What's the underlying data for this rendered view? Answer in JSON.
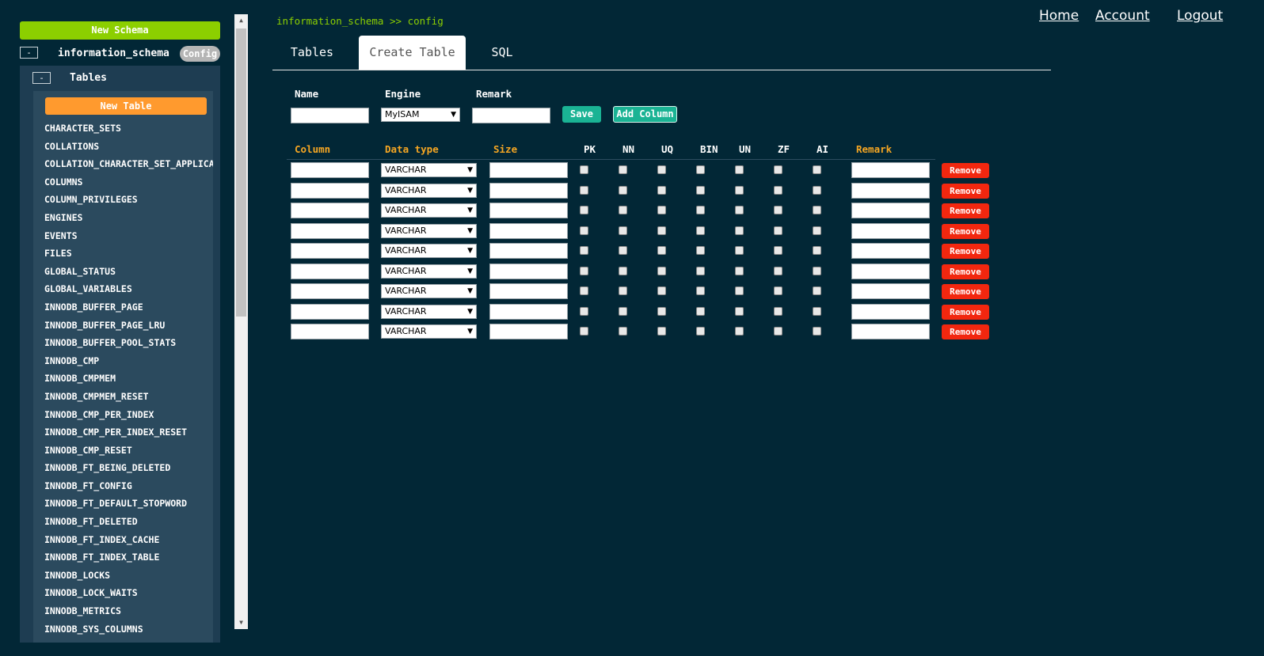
{
  "sidebar": {
    "new_schema_label": "New Schema",
    "schema_toggle": "-",
    "schema_name": "information_schema",
    "config_label": "Config",
    "tables_toggle": "-",
    "tables_label": "Tables",
    "new_table_label": "New Table",
    "tables": [
      "CHARACTER_SETS",
      "COLLATIONS",
      "COLLATION_CHARACTER_SET_APPLICA",
      "COLUMNS",
      "COLUMN_PRIVILEGES",
      "ENGINES",
      "EVENTS",
      "FILES",
      "GLOBAL_STATUS",
      "GLOBAL_VARIABLES",
      "INNODB_BUFFER_PAGE",
      "INNODB_BUFFER_PAGE_LRU",
      "INNODB_BUFFER_POOL_STATS",
      "INNODB_CMP",
      "INNODB_CMPMEM",
      "INNODB_CMPMEM_RESET",
      "INNODB_CMP_PER_INDEX",
      "INNODB_CMP_PER_INDEX_RESET",
      "INNODB_CMP_RESET",
      "INNODB_FT_BEING_DELETED",
      "INNODB_FT_CONFIG",
      "INNODB_FT_DEFAULT_STOPWORD",
      "INNODB_FT_DELETED",
      "INNODB_FT_INDEX_CACHE",
      "INNODB_FT_INDEX_TABLE",
      "INNODB_LOCKS",
      "INNODB_LOCK_WAITS",
      "INNODB_METRICS",
      "INNODB_SYS_COLUMNS"
    ]
  },
  "header": {
    "breadcrumb": "information_schema >> config",
    "nav": {
      "home": "Home",
      "account": "Account",
      "logout": "Logout"
    }
  },
  "tabs": {
    "tables": "Tables",
    "create_table": "Create Table",
    "sql": "SQL"
  },
  "form": {
    "name_label": "Name",
    "engine_label": "Engine",
    "remark_label": "Remark",
    "engine_value": "MyISAM",
    "save_label": "Save",
    "add_column_label": "Add Column"
  },
  "columns": {
    "headers": {
      "column": "Column",
      "data_type": "Data type",
      "size": "Size",
      "pk": "PK",
      "nn": "NN",
      "uq": "UQ",
      "bin": "BIN",
      "un": "UN",
      "zf": "ZF",
      "ai": "AI",
      "remark": "Remark"
    },
    "rows": [
      {
        "type": "VARCHAR"
      },
      {
        "type": "VARCHAR"
      },
      {
        "type": "VARCHAR"
      },
      {
        "type": "VARCHAR"
      },
      {
        "type": "VARCHAR"
      },
      {
        "type": "VARCHAR"
      },
      {
        "type": "VARCHAR"
      },
      {
        "type": "VARCHAR"
      },
      {
        "type": "VARCHAR"
      }
    ],
    "remove_label": "Remove"
  },
  "colors": {
    "background": "#022736",
    "accent_green": "#8ccf00",
    "accent_orange": "#ff9a2e",
    "teal_button": "#1ab394",
    "remove_red": "#f2270f"
  }
}
